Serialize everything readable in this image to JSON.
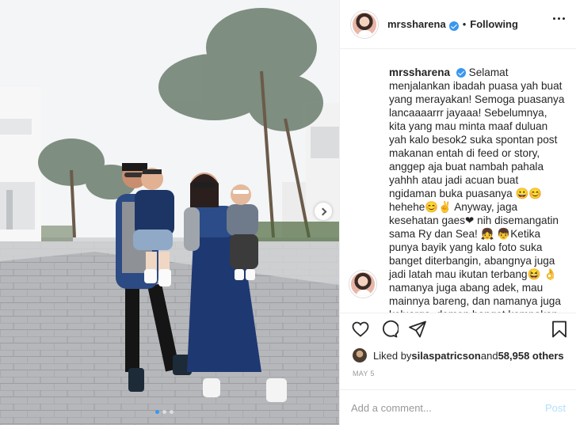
{
  "post": {
    "username": "mrssharena",
    "follow_separator": "•",
    "follow_label": "Following",
    "more_icon": "more-horizontal-icon"
  },
  "caption": {
    "username": "mrssharena",
    "text": "Selamat menjalankan ibadah puasa yah buat yang merayakan! Semoga puasanya lancaaaarrr jayaaa! Sebelumnya, kita yang mau minta maaf duluan yah kalo besok2 suka spontan post makanan entah di feed or story, anggep aja buat nambah pahala yahhh atau jadi acuan buat ngidaman buka puasanya 😀😊hehehe😊✌ Anyway, jaga kesehatan gaes❤ nih disemangatin sama Ry dan Sea! 👧 👦Ketika punya bayik yang kalo foto suka banget diterbangin, abangnya juga jadi latah mau ikutan terbang😆 👌namanya juga abang adek, mau mainnya bareng, dan namanya juga keluarga, demen banget kompakan kembaran baju! HAHAHAHHAHAHA! Ini kita lagi pake baju keluarga..."
  },
  "actions": {
    "like_icon": "heart-icon",
    "comment_icon": "comment-icon",
    "share_icon": "share-icon",
    "save_icon": "bookmark-icon"
  },
  "likes": {
    "prefix": "Liked by ",
    "user": "silaspatricson",
    "middle": " and ",
    "others": "58,958 others"
  },
  "date": "MAY 5",
  "comment_box": {
    "placeholder": "Add a comment...",
    "post_label": "Post"
  },
  "carousel": {
    "slides": 3,
    "active_index": 0,
    "next_icon": "chevron-right-icon"
  },
  "colors": {
    "accent": "#3897f0",
    "post_disabled": "#b2dffc",
    "text": "#262626",
    "muted": "#999999"
  }
}
